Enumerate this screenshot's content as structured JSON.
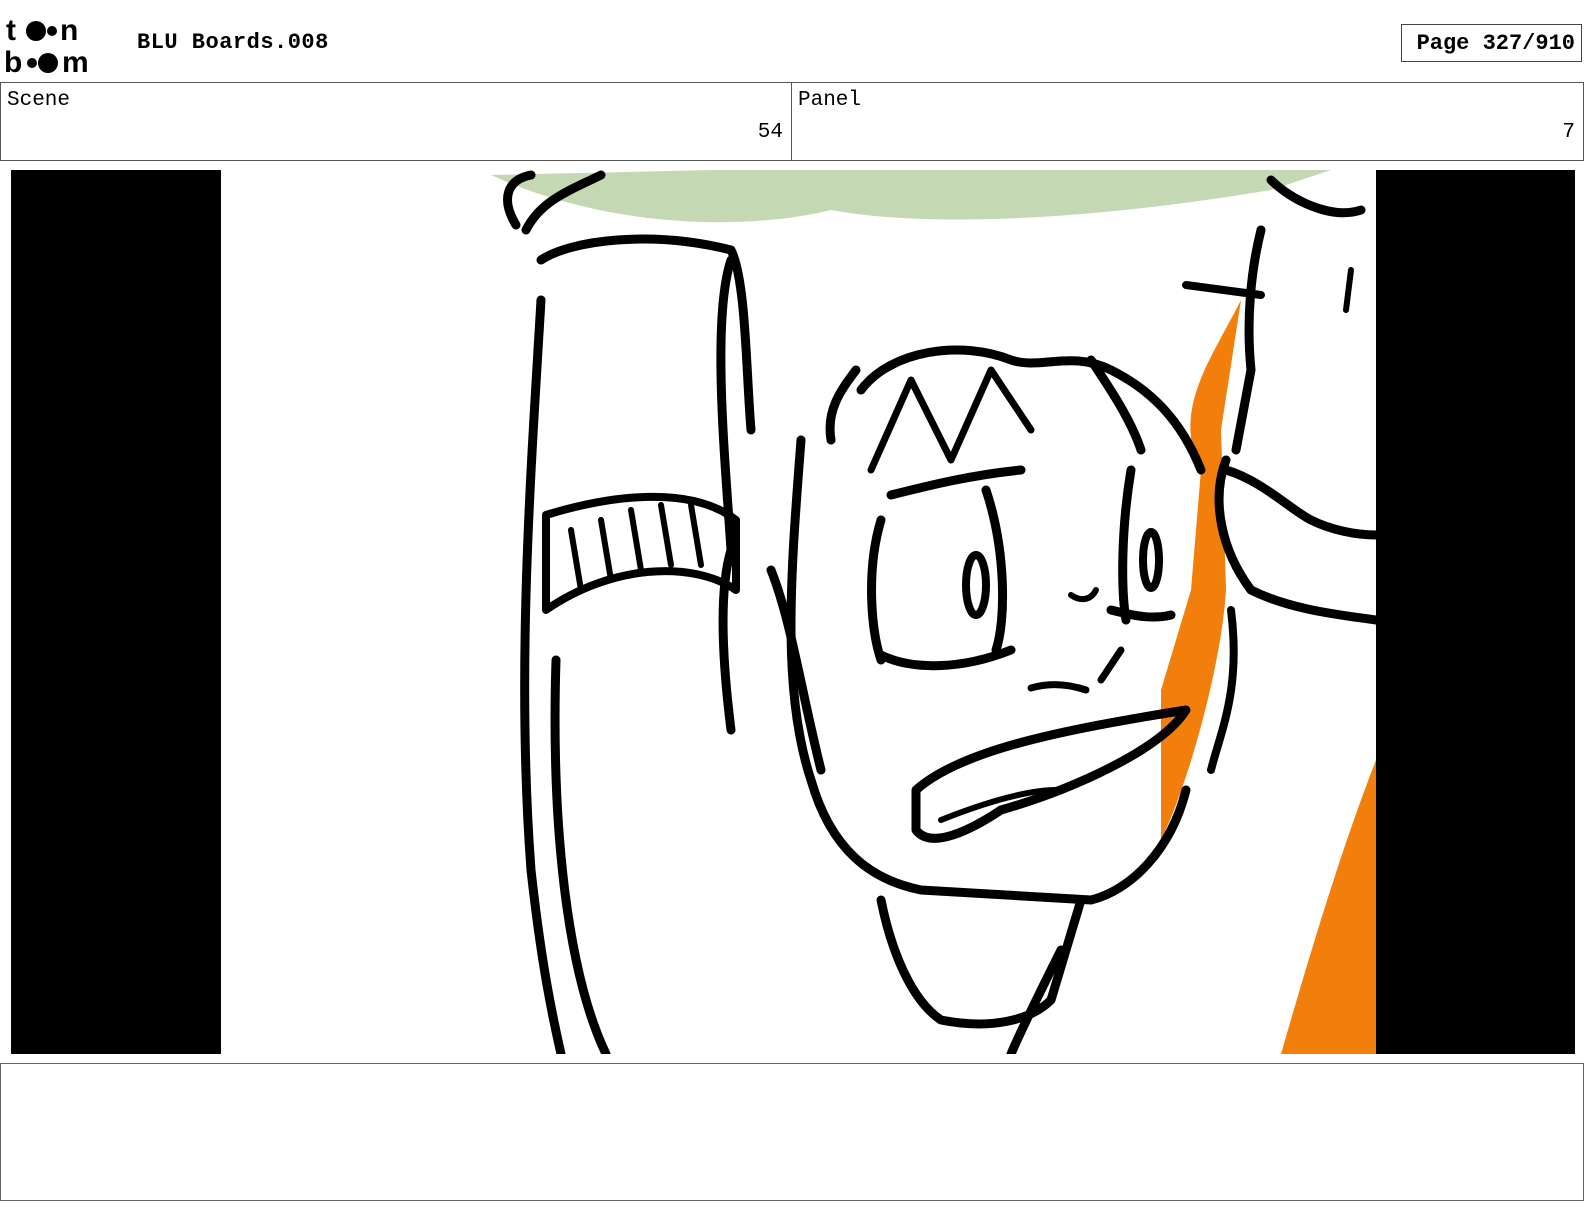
{
  "header": {
    "logo_line1": "toon",
    "logo_line2": "boom",
    "title": "BLU Boards.008",
    "page": "Page 327/910"
  },
  "scene": {
    "label": "Scene",
    "value": "54"
  },
  "panel": {
    "label": "Panel",
    "value": "7"
  },
  "colors": {
    "letterbox": "#000000",
    "ink": "#000000",
    "background_green": "#c5d8b4",
    "orange": "#f27f0c"
  },
  "notes": {
    "text": ""
  }
}
